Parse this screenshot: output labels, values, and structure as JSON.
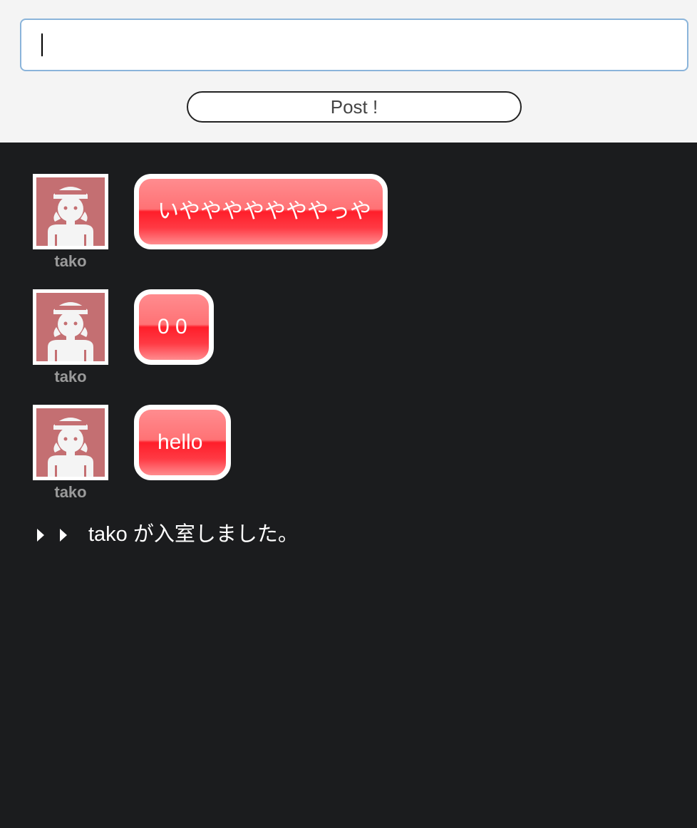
{
  "composer": {
    "input_value": "",
    "post_label": "Post !"
  },
  "messages": [
    {
      "user": "tako",
      "text": "いやややややややっや"
    },
    {
      "user": "tako",
      "text": "0 0"
    },
    {
      "user": "tako",
      "text": "hello"
    }
  ],
  "system": {
    "text": "tako が入室しました。"
  },
  "colors": {
    "header_bg": "#f4f4f4",
    "chat_bg": "#1b1c1e",
    "bubble_red": "#ff1e2a",
    "avatar_bg": "#c46f72"
  }
}
